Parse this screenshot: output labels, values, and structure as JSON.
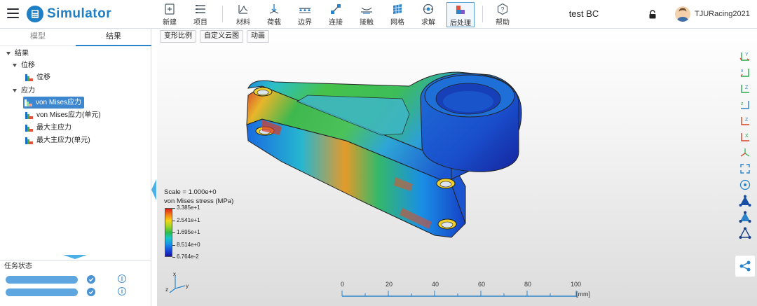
{
  "app": {
    "name": "Simulator",
    "doc_title": "test BC",
    "user": "TJURacing2021"
  },
  "toolbar": {
    "items": [
      {
        "label": "新建",
        "icon": "new-file-icon"
      },
      {
        "label": "项目",
        "icon": "project-icon"
      },
      {
        "label": "材料",
        "icon": "material-icon"
      },
      {
        "label": "荷载",
        "icon": "load-icon"
      },
      {
        "label": "边界",
        "icon": "boundary-icon"
      },
      {
        "label": "连接",
        "icon": "connection-icon"
      },
      {
        "label": "接触",
        "icon": "contact-icon"
      },
      {
        "label": "网格",
        "icon": "mesh-icon"
      },
      {
        "label": "求解",
        "icon": "solve-icon"
      },
      {
        "label": "后处理",
        "icon": "postprocess-icon"
      },
      {
        "label": "帮助",
        "icon": "help-icon"
      }
    ],
    "active": "后处理"
  },
  "left_tabs": [
    "模型",
    "结果"
  ],
  "active_tab": "结果",
  "tree": {
    "root": "结果",
    "groups": [
      {
        "label": "位移",
        "items": [
          "位移"
        ]
      },
      {
        "label": "应力",
        "items": [
          "von Mises应力",
          "von Mises应力(单元)",
          "最大主应力",
          "最大主应力(单元)"
        ]
      }
    ],
    "selected": "von Mises应力"
  },
  "task_status": {
    "title": "任务状态",
    "tasks": [
      {
        "status": "done"
      },
      {
        "status": "done"
      }
    ]
  },
  "viewport": {
    "buttons": [
      "变形比例",
      "自定义云图",
      "动画"
    ],
    "legend": {
      "scale": "Scale = 1.000e+0",
      "title": "von Mises stress (MPa)",
      "labels": [
        "3.385e+1",
        "2.541e+1",
        "1.695e+1",
        "8.514e+0",
        "6.764e-2"
      ]
    },
    "axes": {
      "x": "x",
      "y": "y",
      "z": "z"
    },
    "scale_bar": {
      "ticks": [
        "0",
        "20",
        "40",
        "60",
        "80",
        "100"
      ],
      "unit": "[mm]"
    }
  },
  "colors": {
    "accent": "#2b83c9",
    "selected": "#3d86d0",
    "task_bar": "#5ea6e0"
  }
}
